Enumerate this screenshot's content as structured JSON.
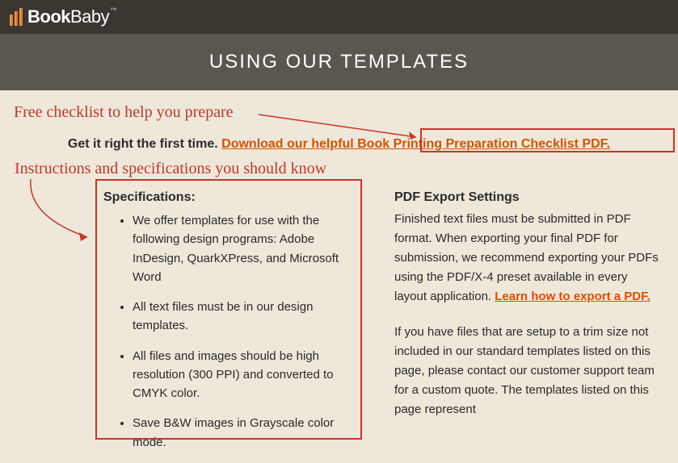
{
  "brand": {
    "name_bold": "Book",
    "name_light": "Baby",
    "tm": "™"
  },
  "banner": {
    "title": "USING OUR TEMPLATES"
  },
  "annotations": {
    "checklist": "Free checklist to help you prepare",
    "instructions": "Instructions and specifications you should know"
  },
  "intro": {
    "prefix": "Get it right the first time. ",
    "link_text": "Download our helpful Book Printing Preparation Checklist PDF."
  },
  "specs": {
    "title": "Specifications:",
    "items": [
      "We offer templates for use with the following design programs: Adobe InDesign, QuarkXPress, and Microsoft Word",
      "All text files must be in our design templates.",
      "All files and images should be high resolution (300 PPI) and converted to CMYK color.",
      "Save B&W images in Grayscale color mode."
    ]
  },
  "pdf": {
    "title": "PDF Export Settings",
    "body1": "Finished text files must be submitted in PDF format. When exporting your final PDF for submission, we recommend exporting your PDFs using the PDF/X-4 preset available in every layout application. ",
    "link_text": "Learn how to export a PDF.",
    "body2": "If you have files that are setup to a trim size not included in our standard templates listed on this page, please contact our customer support team for a custom quote. The templates listed on this page represent"
  }
}
